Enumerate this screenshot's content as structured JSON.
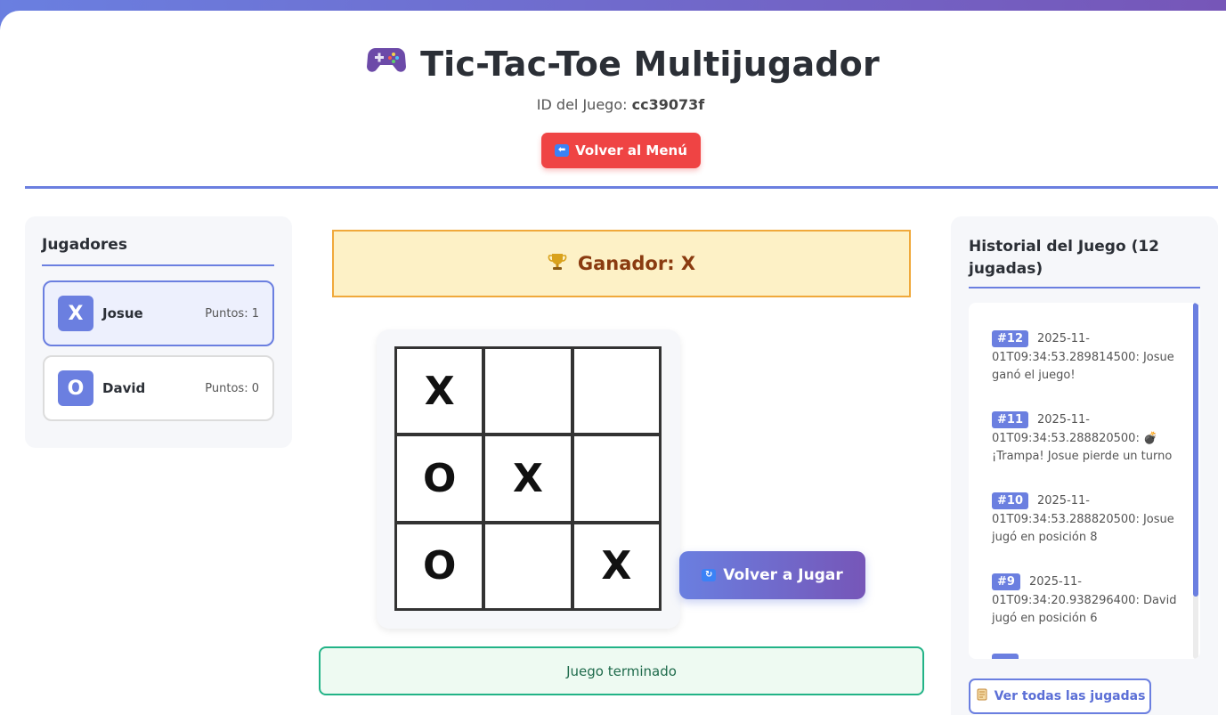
{
  "header": {
    "title": "Tic-Tac-Toe Multijugador",
    "title_icon": "gamepad-icon",
    "game_id_label": "ID del Juego:",
    "game_id": "cc39073f",
    "back_label": "Volver al Menú",
    "back_icon": "left-arrow-icon"
  },
  "players": {
    "title": "Jugadores",
    "list": [
      {
        "symbol": "X",
        "name": "Josue",
        "score": "Puntos: 1",
        "active": true
      },
      {
        "symbol": "O",
        "name": "David",
        "score": "Puntos: 0",
        "active": false
      }
    ]
  },
  "game": {
    "winner_text": "Ganador: X",
    "winner_icon": "trophy-icon",
    "board": [
      "X",
      "",
      "",
      "O",
      "X",
      "",
      "O",
      "",
      "X"
    ],
    "replay_label": "Volver a Jugar",
    "replay_icon": "refresh-icon",
    "status": "Juego terminado"
  },
  "history": {
    "title": "Historial del Juego (12 jugadas)",
    "entries": [
      {
        "num": "#12",
        "text": "2025-11-01T09:34:53.289814500: Josue ganó el juego!"
      },
      {
        "num": "#11",
        "text": "2025-11-01T09:34:53.288820500: 💣 ¡Trampa! Josue pierde un turno"
      },
      {
        "num": "#10",
        "text": "2025-11-01T09:34:53.288820500: Josue jugó en posición 8"
      },
      {
        "num": "#9",
        "text": "2025-11-01T09:34:20.938296400: David jugó en posición 6"
      }
    ],
    "all_label": "Ver todas las jugadas",
    "all_icon": "scroll-icon"
  },
  "colors": {
    "accent": "#6b7fe0",
    "danger": "#ef4444",
    "winner_bg": "#fdf1c6",
    "status_border": "#22b387"
  }
}
